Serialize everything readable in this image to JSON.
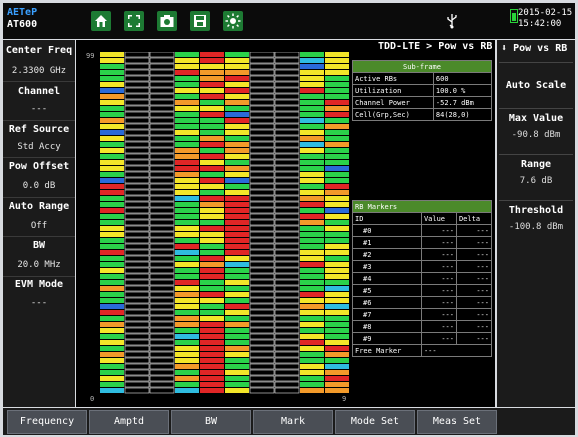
{
  "app": {
    "brand_line1": "AETeP",
    "model": "AT600",
    "date": "2015-02-15",
    "time": "15:42:00"
  },
  "toolbar": {
    "icons": [
      "home-icon",
      "fullscreen-icon",
      "camera-icon",
      "save-icon",
      "brightness-icon"
    ],
    "usb_icon": "usb-icon",
    "battery_icon": "battery-icon",
    "accent": "#1d7a33"
  },
  "left_panel": {
    "items": [
      {
        "label": "Center Freq",
        "value": "2.3300 GHz"
      },
      {
        "label": "Channel",
        "value": "---"
      },
      {
        "label": "Ref Source",
        "value": "Std Accy"
      },
      {
        "label": "Pow Offset",
        "value": "0.0 dB"
      },
      {
        "label": "Auto Range",
        "value": "Off"
      },
      {
        "label": "BW",
        "value": "20.0 MHz"
      },
      {
        "label": "EVM Mode",
        "value": "---"
      }
    ]
  },
  "plot": {
    "title": "TDD-LTE > Pow vs RB",
    "y_top": "99",
    "y_bottom": "0",
    "x_right": "9"
  },
  "subframe_table": {
    "header": "Sub-frame",
    "rows": [
      {
        "name": "Active RBs",
        "value": "600"
      },
      {
        "name": "Utilization",
        "value": "100.0 %"
      },
      {
        "name": "Channel Power",
        "value": "-52.7 dBm"
      },
      {
        "name": "Cell(Grp,Sec)",
        "value": "84(28,0)"
      }
    ]
  },
  "rb_markers": {
    "title": "RB Markers",
    "col_id": "ID",
    "col_value": "Value",
    "col_delta": "Delta",
    "rows": [
      {
        "id": "#0",
        "value": "---",
        "delta": "---"
      },
      {
        "id": "#1",
        "value": "---",
        "delta": "---"
      },
      {
        "id": "#2",
        "value": "---",
        "delta": "---"
      },
      {
        "id": "#3",
        "value": "---",
        "delta": "---"
      },
      {
        "id": "#4",
        "value": "---",
        "delta": "---"
      },
      {
        "id": "#5",
        "value": "---",
        "delta": "---"
      },
      {
        "id": "#6",
        "value": "---",
        "delta": "---"
      },
      {
        "id": "#7",
        "value": "---",
        "delta": "---"
      },
      {
        "id": "#8",
        "value": "---",
        "delta": "---"
      },
      {
        "id": "#9",
        "value": "---",
        "delta": "---"
      }
    ],
    "free_marker_label": "Free Marker",
    "free_marker_value": "---"
  },
  "right_panel": {
    "title": "Pow vs RB",
    "auto_scale": "Auto Scale",
    "max_value_label": "Max Value",
    "max_value": "-90.8 dBm",
    "range_label": "Range",
    "range_value": "7.6 dB",
    "threshold_label": "Threshold",
    "threshold_value": "-100.8 dBm"
  },
  "bottom_bar": {
    "buttons": [
      "Frequency",
      "Amptd",
      "BW",
      "Mark",
      "Mode Set",
      "Meas Set"
    ]
  },
  "heatmap_colors": {
    "green": "#2bd14a",
    "yellow": "#f3e629",
    "orange": "#f39a2a",
    "red": "#e02626",
    "cyan": "#2fbce0",
    "blue": "#2a6ad8"
  }
}
